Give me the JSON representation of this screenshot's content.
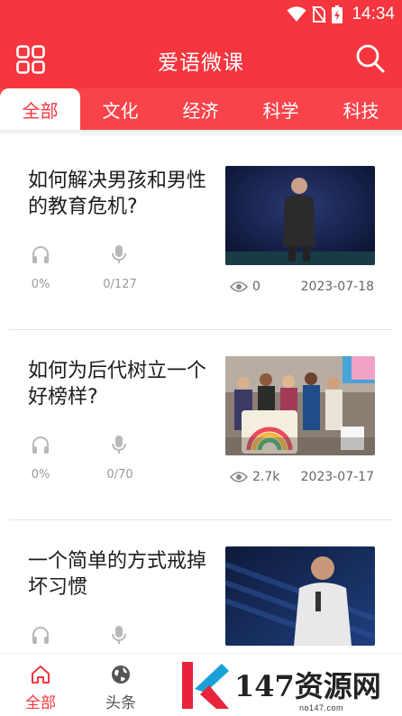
{
  "status_bar": {
    "time": "14:34"
  },
  "header": {
    "title": "爱语微课"
  },
  "tabs": [
    {
      "label": "全部"
    },
    {
      "label": "文化"
    },
    {
      "label": "经济"
    },
    {
      "label": "科学"
    },
    {
      "label": "科技"
    }
  ],
  "articles": [
    {
      "title": "如何解决男孩和男性的教育危机?",
      "listen_progress": "0%",
      "speak_progress": "0/127",
      "views": "0",
      "date": "2023-07-18"
    },
    {
      "title": "如何为后代树立一个好榜样?",
      "listen_progress": "0%",
      "speak_progress": "0/70",
      "views": "2.7k",
      "date": "2023-07-17"
    },
    {
      "title": "一个简单的方式戒掉坏习惯",
      "listen_progress": "",
      "speak_progress": "",
      "views": "",
      "date": ""
    }
  ],
  "bottom_nav": [
    {
      "label": "全部",
      "icon": "home-icon"
    },
    {
      "label": "头条",
      "icon": "globe-icon"
    }
  ],
  "watermark": {
    "text": "147资源网",
    "url": "no147.com"
  },
  "colors": {
    "accent": "#f5363f",
    "tab_bar": "#f9434a",
    "muted": "#9a9a9a"
  }
}
